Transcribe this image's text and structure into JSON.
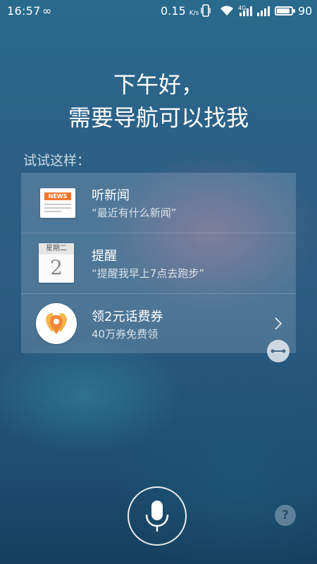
{
  "status_bar": {
    "time": "16:57",
    "loop_symbol": "∞",
    "net_speed": "0.15",
    "net_speed_unit": "K/s",
    "network": "4G",
    "battery": "90"
  },
  "greeting": {
    "line1": "下午好，",
    "line2": "需要导航可以找我"
  },
  "try_label": "试试这样：",
  "suggestions": [
    {
      "title": "听新闻",
      "subtitle": "“最近有什么新闻”",
      "icon": "news-icon",
      "icon_text": "NEWS"
    },
    {
      "title": "提醒",
      "subtitle": "“提醒我早上7点去跑步”",
      "icon": "calendar-icon",
      "icon_header": "星期二",
      "icon_number": "2"
    },
    {
      "title": "领2元话费券",
      "subtitle": "40万券免费领",
      "icon": "location-pin-icon"
    }
  ],
  "colors": {
    "news_orange": "#f0772f",
    "pin_orange": "#f0883a",
    "pin_yellow": "#f6b64a"
  },
  "help_label": "?"
}
